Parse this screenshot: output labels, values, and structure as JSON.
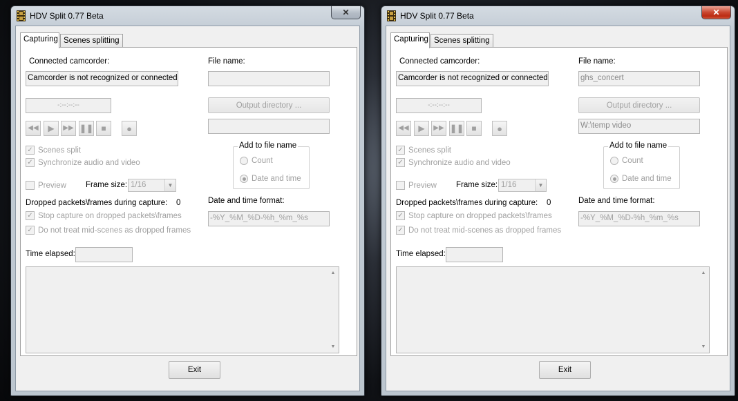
{
  "windows": [
    {
      "title": "HDV Split 0.77 Beta",
      "close_glyph": "✕",
      "tabs": [
        "Capturing",
        "Scenes splitting"
      ],
      "connected_camcorder_label": "Connected camcorder:",
      "camcorder_status": "Camcorder is not recognized or connected",
      "timecode": "-:--:--:--",
      "file_name_label": "File name:",
      "file_name_value": "",
      "output_directory_button": "Output directory ...",
      "output_directory_value": "",
      "controls": [
        "rewind-icon",
        "play-icon",
        "fast-forward-icon",
        "pause-icon",
        "stop-icon",
        "record-icon"
      ],
      "scenes_split": {
        "label": "Scenes split",
        "checked": true
      },
      "sync_av": {
        "label": "Synchronize audio and video",
        "checked": true
      },
      "add_to_file_name": {
        "caption": "Add to file name",
        "count": "Count",
        "date_time": "Date and time",
        "selected": "date_time"
      },
      "preview": {
        "label": "Preview",
        "checked": false
      },
      "frame_size_label": "Frame size:",
      "frame_size_value": "1/16",
      "dropped_label": "Dropped packets\\frames during capture:",
      "dropped_count": "0",
      "stop_on_dropped": {
        "label": "Stop capture on dropped packets\\frames",
        "checked": true
      },
      "no_midscenes": {
        "label": "Do not treat mid-scenes as dropped frames",
        "checked": true
      },
      "date_format_label": "Date and time format:",
      "date_format_value": "-%Y_%M_%D-%h_%m_%s",
      "time_elapsed_label": "Time elapsed:",
      "time_elapsed_value": "",
      "log_text": "",
      "exit_label": "Exit"
    },
    {
      "title": "HDV Split 0.77 Beta",
      "close_glyph": "✕",
      "tabs": [
        "Capturing",
        "Scenes splitting"
      ],
      "connected_camcorder_label": "Connected camcorder:",
      "camcorder_status": "Camcorder is not recognized or connected",
      "timecode": "-:--:--:--",
      "file_name_label": "File name:",
      "file_name_value": "ghs_concert",
      "output_directory_button": "Output directory ...",
      "output_directory_value": "W:\\temp video",
      "controls": [
        "rewind-icon",
        "play-icon",
        "fast-forward-icon",
        "pause-icon",
        "stop-icon",
        "record-icon"
      ],
      "scenes_split": {
        "label": "Scenes split",
        "checked": true
      },
      "sync_av": {
        "label": "Synchronize audio and video",
        "checked": true
      },
      "add_to_file_name": {
        "caption": "Add to file name",
        "count": "Count",
        "date_time": "Date and time",
        "selected": "date_time"
      },
      "preview": {
        "label": "Preview",
        "checked": false
      },
      "frame_size_label": "Frame size:",
      "frame_size_value": "1/16",
      "dropped_label": "Dropped packets\\frames during capture:",
      "dropped_count": "0",
      "stop_on_dropped": {
        "label": "Stop capture on dropped packets\\frames",
        "checked": true
      },
      "no_midscenes": {
        "label": "Do not treat mid-scenes as dropped frames",
        "checked": true
      },
      "date_format_label": "Date and time format:",
      "date_format_value": "-%Y_%M_%D-%h_%m_%s",
      "time_elapsed_label": "Time elapsed:",
      "time_elapsed_value": "",
      "log_text": "",
      "exit_label": "Exit"
    }
  ]
}
